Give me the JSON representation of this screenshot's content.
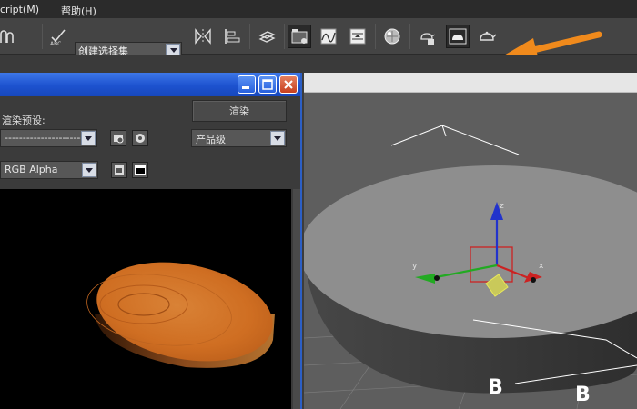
{
  "menu": {
    "script": "cript(M)",
    "help": "帮助(H)"
  },
  "toolbar": {
    "selection_set": "创建选择集",
    "buttons": [
      "paint-selection",
      "spellcheck",
      "mirror",
      "align",
      "layer-manager",
      "curve-editor",
      "schematic-view",
      "material-editor",
      "render-setup",
      "rendered-frame-window",
      "render-production",
      "render-iterative"
    ],
    "arrow_color": "#f08a1c"
  },
  "render_window": {
    "preset_label": "渲染预设:",
    "preset_value": "----------------------",
    "render_button": "渲染",
    "mode_value": "产品级",
    "channel_value": "RGB Alpha"
  },
  "viewport": {
    "gizmo_labels": {
      "x": "x",
      "y": "y",
      "z": "z"
    },
    "watermark": [
      "B",
      "B"
    ]
  },
  "colors": {
    "title_blue": "#1d52cf",
    "wood": "#c96a22",
    "gizmo_x": "#d22",
    "gizmo_y": "#2a2",
    "gizmo_z": "#23c"
  }
}
